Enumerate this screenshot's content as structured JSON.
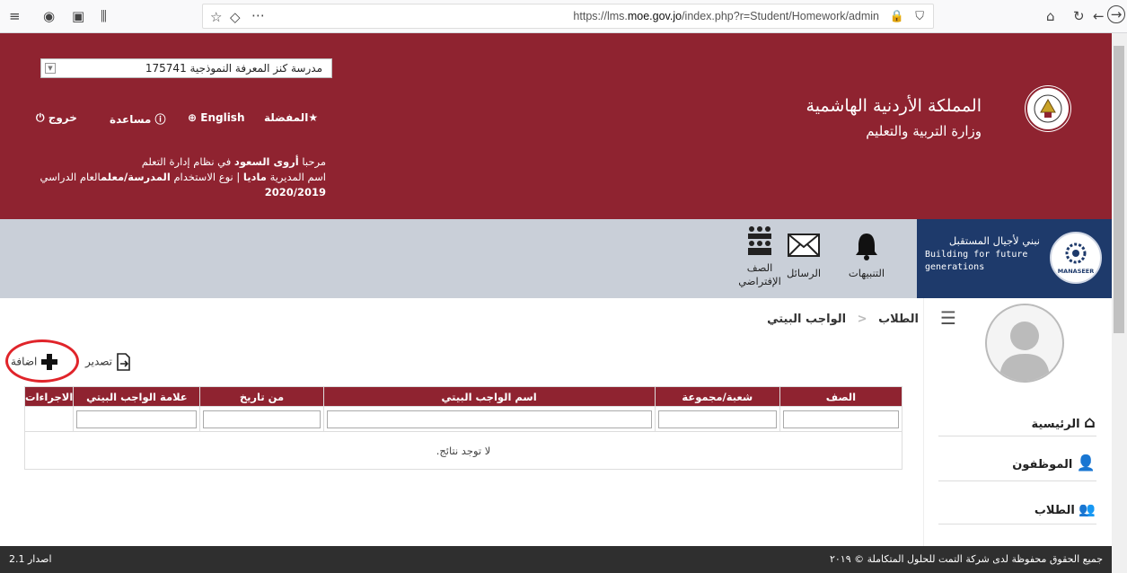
{
  "browser": {
    "url_prefix": "https://lms.",
    "url_domain": "moe.gov.jo",
    "url_path": "/index.php?r=Student/Homework/admin"
  },
  "header": {
    "school_select": "مدرسة كنز المعرفة النموذجية 175741",
    "links": {
      "logout": "خروج",
      "help": "مساعدة",
      "english": "English",
      "favorites": "المفضلة"
    },
    "welcome_prefix": "مرحبا",
    "welcome_name": "أروى السعود",
    "welcome_suffix": "في نظام إدارة التعلم",
    "info_prefix": "اسم المديرية",
    "directorate": "ماديا",
    "info_mid": "| نوع الاستخدام",
    "usage_type": "المدرسة/معلم",
    "info_suffix": "العام الدراسي",
    "year": "2020/2019",
    "kingdom": "المملكة الأردنية الهاشمية",
    "ministry": "وزارة التربية والتعليم"
  },
  "nav": {
    "virtual_class": "الصف الإفتراضي",
    "messages": "الرسائل",
    "alerts": "التنبيهات"
  },
  "brand": {
    "tagline_ar": "نبني لأجيال المستقبل",
    "tagline_en_1": "Building for future",
    "tagline_en_2": "generations",
    "logo_text": "MANASEER"
  },
  "breadcrumb": {
    "root": "الطلاب",
    "current": "الواجب البيتي"
  },
  "actions": {
    "export": "تصدير",
    "add": "اضافة"
  },
  "table": {
    "columns": [
      "الصف",
      "شعبة/مجموعة",
      "اسم الواجب البيتي",
      "من تاريخ",
      "علامة الواجب البيتي",
      "الاجراءات"
    ],
    "empty": "لا توجد نتائج."
  },
  "sidebar": {
    "items": [
      {
        "label": "الرئيسية",
        "icon": "home-icon"
      },
      {
        "label": "الموظفون",
        "icon": "user-icon"
      },
      {
        "label": "الطلاب",
        "icon": "students-icon"
      }
    ]
  },
  "footer": {
    "version": "اصدار 2.1",
    "copyright": "جميع الحقوق محفوظة لدى شركة التمت للحلول المتكاملة © ٢٠١٩"
  },
  "colors": {
    "header_red": "#8f2330",
    "band_grey": "#c9cfd8",
    "annotation_red": "#e0242a"
  }
}
